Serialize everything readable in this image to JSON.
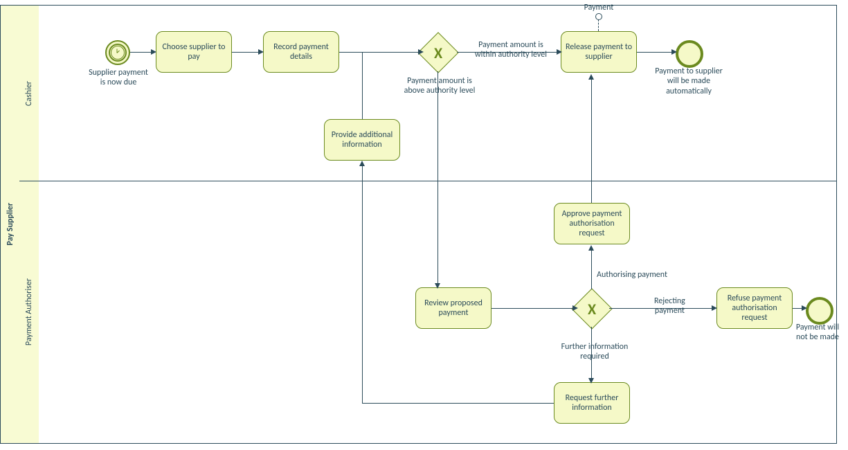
{
  "pool": {
    "title": "Pay Supplier"
  },
  "lanes": {
    "cashier": "Cashier",
    "authoriser": "Payment Authoriser"
  },
  "events": {
    "start": "Supplier payment\nis now due",
    "end1": "Payment to supplier\nwill be made\nautomatically",
    "end2": "Payment will\nnot be made",
    "msg": "Payment"
  },
  "tasks": {
    "choose": "Choose supplier to pay",
    "record": "Record payment details",
    "provide": "Provide additional information",
    "release": "Release payment to supplier",
    "review": "Review proposed payment",
    "approve": "Approve payment authorisation request",
    "refuse": "Refuse payment authorisation request",
    "request": "Request further information"
  },
  "gateway_labels": {
    "g1_above": "Payment amount is\nabove authority level",
    "g1_within": "Payment amount is\nwithin authority level",
    "g2_auth": "Authorising payment",
    "g2_reject": "Rejecting\npayment",
    "g2_info": "Further information\nrequired"
  }
}
